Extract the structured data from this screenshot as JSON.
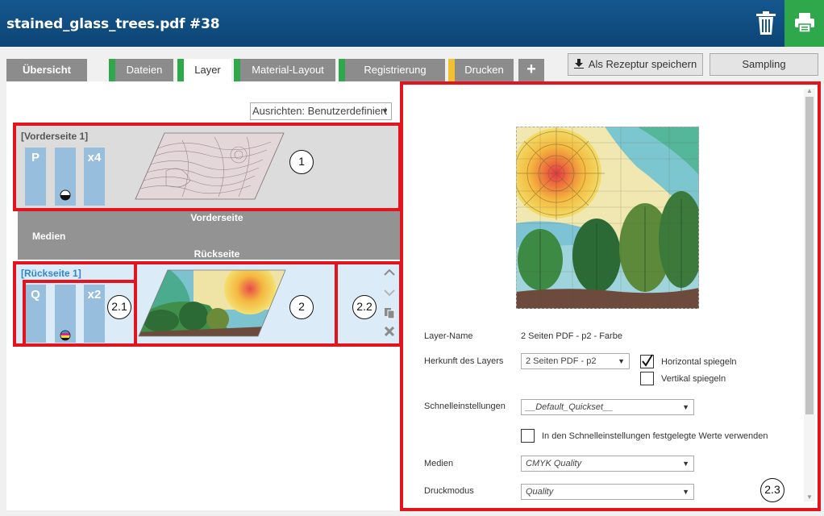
{
  "header": {
    "title": "stained_glass_trees.pdf #38",
    "trash_icon": "trash-icon",
    "print_icon": "printer-icon",
    "colors": {
      "header_bg": "#14578f",
      "print_bg": "#2ea84a"
    }
  },
  "tabs": [
    {
      "label": "Übersicht",
      "active": false,
      "stripe": null
    },
    {
      "label": "Dateien",
      "active": false,
      "stripe": "#2ea84a"
    },
    {
      "label": "Layer",
      "active": true,
      "stripe": "#2ea84a"
    },
    {
      "label": "Material-Layout",
      "active": false,
      "stripe": "#2ea84a"
    },
    {
      "label": "Registrierung",
      "active": false,
      "stripe": "#2ea84a"
    },
    {
      "label": "Drucken",
      "active": false,
      "stripe": "#f2c12e"
    },
    {
      "label": "+",
      "active": false,
      "stripe": null
    }
  ],
  "actions": {
    "save_recipe": "Als Rezeptur speichern",
    "save_icon": "download-icon",
    "sampling": "Sampling"
  },
  "left": {
    "align_select": "Ausrichten: Benutzerdefiniert",
    "front_layer": {
      "label": "[Vorderseite 1]",
      "chips": [
        "P",
        "",
        "x4"
      ],
      "callout": "1"
    },
    "media_band": {
      "top": "Vorderseite",
      "middle": "Medien",
      "bottom": "Rückseite"
    },
    "back_layer": {
      "label": "[Rückseite 1]",
      "chips": [
        "Q",
        "",
        "x2"
      ],
      "callout_chips": "2.1",
      "callout": "2",
      "callout_icons": "2.2",
      "icons": [
        "chevron-up-icon",
        "chevron-down-icon",
        "copy-icon",
        "delete-icon"
      ]
    }
  },
  "right": {
    "callout": "2.3",
    "preview_image": "stained-glass-trees-preview",
    "layer_name_label": "Layer-Name",
    "layer_name_value": "2 Seiten PDF - p2 - Farbe",
    "origin_label": "Herkunft des Layers",
    "origin_value": "2 Seiten PDF - p2",
    "mirror_h_label": "Horizontal spiegeln",
    "mirror_h_checked": true,
    "mirror_v_label": "Vertikal spiegeln",
    "mirror_v_checked": false,
    "quick_label": "Schnelleinstellungen",
    "quick_value": "__Default_Quickset__",
    "quick_values_label": "In den Schnelleinstellungen festgelegte Werte verwenden",
    "quick_values_checked": false,
    "media_label": "Medien",
    "media_value": "CMYK Quality",
    "mode_label": "Druckmodus",
    "mode_value": "Quality"
  },
  "colors": {
    "highlight_red": "#e4141e",
    "chip_blue": "#98bedd"
  }
}
